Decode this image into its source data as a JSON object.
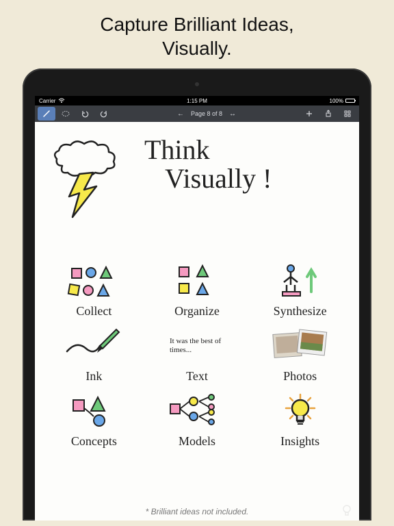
{
  "headline_line1": "Capture Brilliant Ideas,",
  "headline_line2": "Visually.",
  "statusbar": {
    "carrier": "Carrier",
    "time": "1:15 PM",
    "battery": "100%"
  },
  "toolbar": {
    "page_label": "Page 8 of 8"
  },
  "canvas": {
    "title_line1": "Think",
    "title_line2": "Visually !",
    "items": {
      "collect": "Collect",
      "organize": "Organize",
      "synthesize": "Synthesize",
      "ink": "Ink",
      "text": "Text",
      "text_sample": "It was the best of times...",
      "photos": "Photos",
      "concepts": "Concepts",
      "models": "Models",
      "insights": "Insights"
    }
  },
  "footer_note": "* Brilliant ideas not included."
}
